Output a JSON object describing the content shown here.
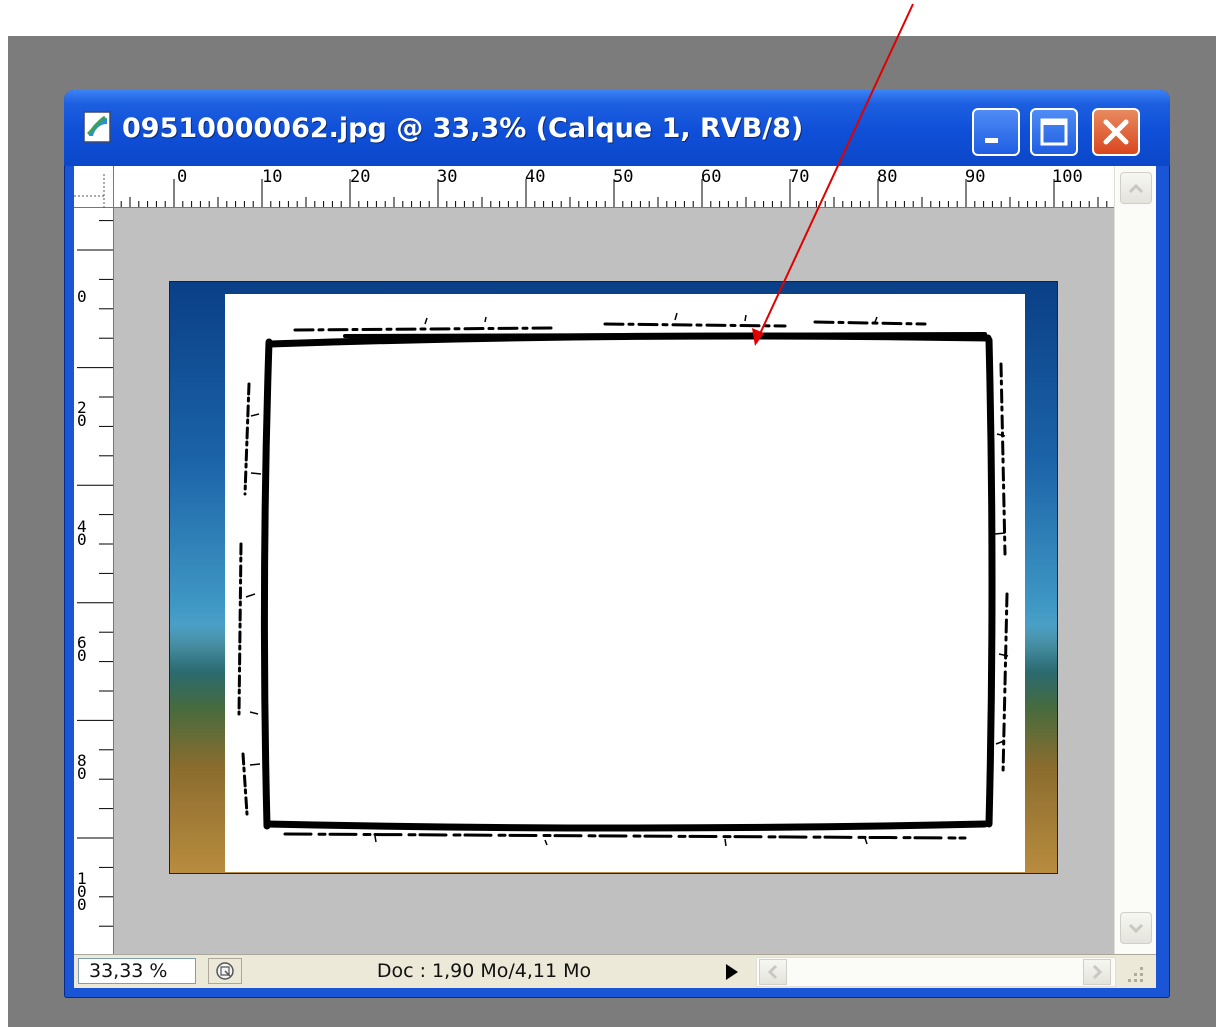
{
  "window": {
    "title": "09510000062.jpg @ 33,3% (Calque 1, RVB/8)",
    "icon": "photoshop-document-icon",
    "controls": [
      "minimize-icon",
      "maximize-icon",
      "close-icon"
    ]
  },
  "rulers": {
    "horizontal": [
      "0",
      "10",
      "20",
      "30",
      "40",
      "50",
      "60",
      "70",
      "80",
      "90",
      "100"
    ],
    "vertical": [
      "0",
      "20",
      "40",
      "60",
      "80",
      "100"
    ]
  },
  "statusbar": {
    "zoom": "33,33 %",
    "doc_info": "Doc : 1,90 Mo/4,11 Mo"
  },
  "colors": {
    "titlebar": "#0f4fd8",
    "close_button": "#d9461f",
    "canvas_background": "#c0c0c0",
    "annotation_arrow": "#e00000"
  }
}
